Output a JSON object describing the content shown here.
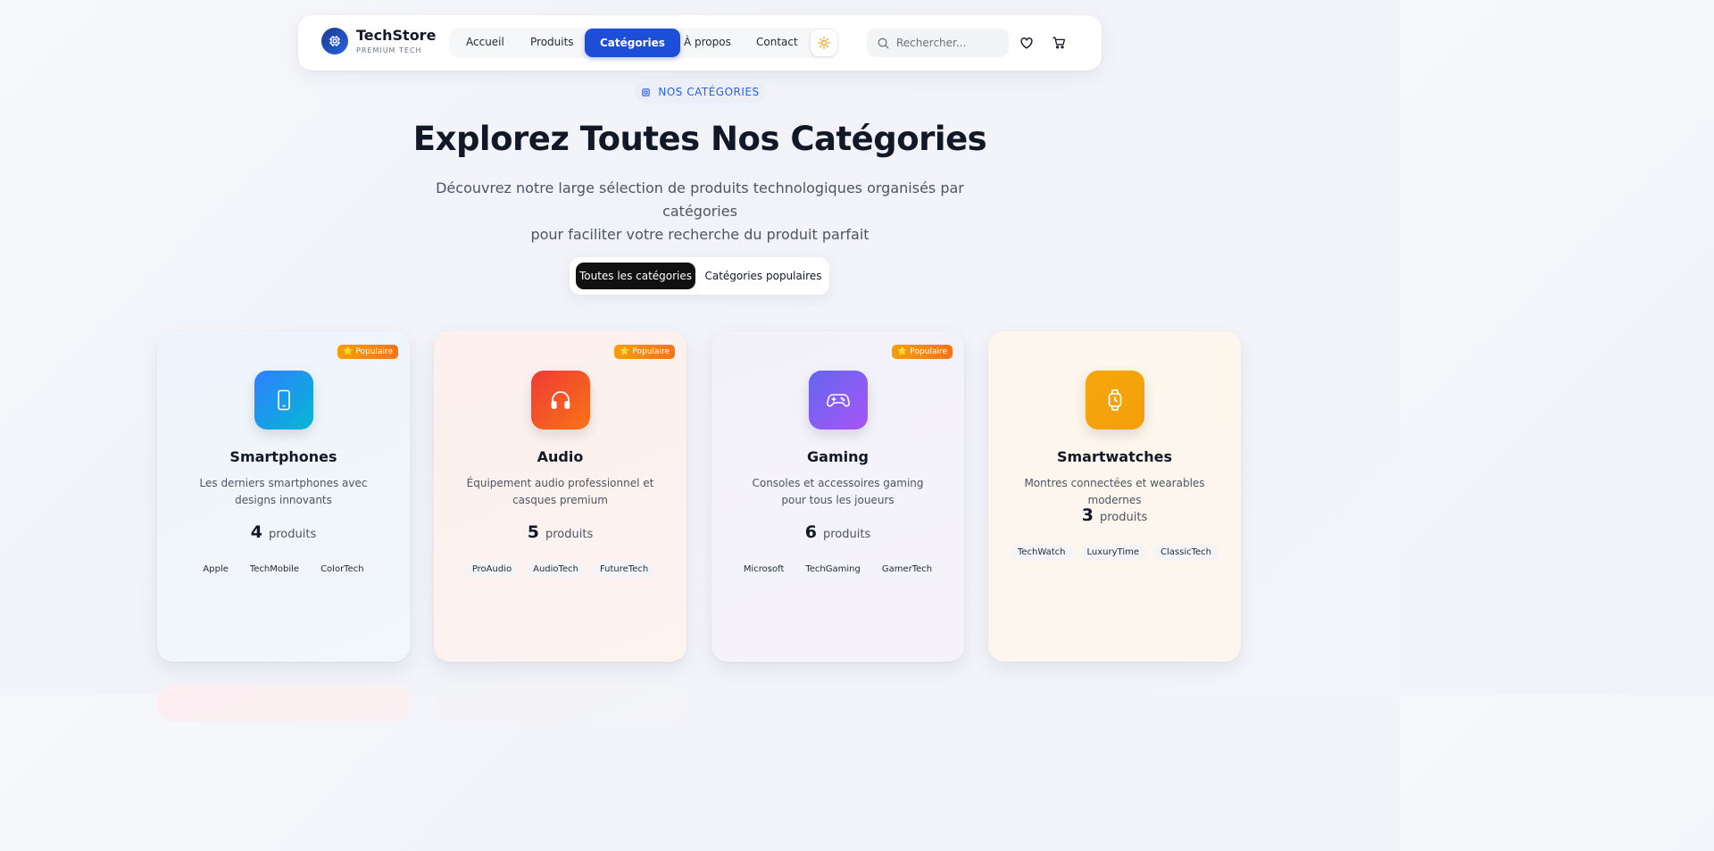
{
  "brand": {
    "name": "TechStore",
    "tagline": "PREMIUM TECH",
    "logo_icon": "chip-icon"
  },
  "nav": {
    "items": [
      {
        "label": "Accueil",
        "active": false
      },
      {
        "label": "Produits",
        "active": false
      },
      {
        "label": "Catégories",
        "active": true
      },
      {
        "label": "À propos",
        "active": false
      },
      {
        "label": "Contact",
        "active": false
      }
    ],
    "theme_icon": "sun-icon",
    "search_placeholder": "Rechercher...",
    "wishlist_icon": "heart-icon",
    "cart_icon": "cart-icon"
  },
  "hero": {
    "eyebrow": "NOS CATÉGORIES",
    "title": "Explorez Toutes Nos Catégories",
    "subtitle_line1": "Découvrez notre large sélection de produits technologiques organisés par catégories",
    "subtitle_line2": "pour faciliter votre recherche du produit parfait"
  },
  "tabs": [
    {
      "label": "Toutes les catégories",
      "active": true
    },
    {
      "label": "Catégories populaires",
      "active": false
    }
  ],
  "categories": [
    {
      "name": "Smartphones",
      "description": "Les derniers smartphones avec designs innovants",
      "count": "4",
      "count_label": "produits",
      "badge": "⭐ Populaire",
      "icon": "smartphone-icon",
      "brands": [
        "Apple",
        "TechMobile",
        "ColorTech"
      ],
      "colors": {
        "from": "#2f80ff",
        "to": "#06b6d4",
        "bg": "#eef5fb"
      }
    },
    {
      "name": "Audio",
      "description": "Équipement audio professionnel et casques premium",
      "count": "5",
      "count_label": "produits",
      "badge": "⭐ Populaire",
      "icon": "headphones-icon",
      "brands": [
        "ProAudio",
        "AudioTech",
        "FutureTech"
      ],
      "colors": {
        "from": "#ef4444",
        "to": "#f97316",
        "bg": "#fdf1ef"
      }
    },
    {
      "name": "Gaming",
      "description": "Consoles et accessoires gaming pour tous les joueurs",
      "count": "6",
      "count_label": "produits",
      "badge": "⭐ Populaire",
      "icon": "gamepad-icon",
      "brands": [
        "Microsoft",
        "TechGaming",
        "GamerTech"
      ],
      "colors": {
        "from": "#6366f1",
        "to": "#a855f7",
        "bg": "#f3f1fa"
      }
    },
    {
      "name": "Smartwatches",
      "description": "Montres connectées et wearables modernes",
      "count": "3",
      "count_label": "produits",
      "badge": "",
      "icon": "watch-icon",
      "brands": [
        "TechWatch",
        "LuxuryTime",
        "ClassicTech"
      ],
      "colors": {
        "from": "#f59e0b",
        "to": "#f97316",
        "bg": "#fdf6ec"
      }
    }
  ]
}
